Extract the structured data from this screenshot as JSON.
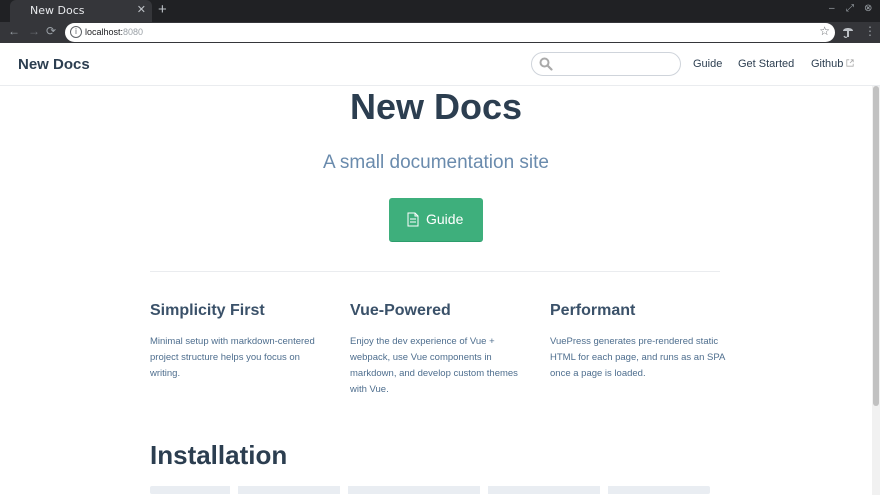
{
  "browser": {
    "tab_title": "New Docs",
    "tab_close": "✕",
    "new_tab": "+",
    "url_host": "localhost:",
    "url_port": "8080",
    "info_glyph": "i",
    "star_glyph": "☆",
    "back_glyph": "←",
    "forward_glyph": "→",
    "reload_glyph": "⟳",
    "menu_glyph": "⋮",
    "minimize_glyph": "–",
    "restore_glyph": "⤢",
    "close_glyph": "⊗"
  },
  "site": {
    "brand": "New Docs",
    "search": {
      "value": "",
      "placeholder": ""
    },
    "nav": [
      {
        "label": "Guide"
      },
      {
        "label": "Get Started"
      },
      {
        "label": "Github"
      }
    ]
  },
  "hero": {
    "title": "New Docs",
    "description": "A small documentation site",
    "action_label": "Guide"
  },
  "features": [
    {
      "title": "Simplicity First",
      "text": "Minimal setup with markdown-centered project structure helps you focus on writing."
    },
    {
      "title": "Vue-Powered",
      "text": "Enjoy the dev experience of Vue + webpack, use Vue components in markdown, and develop custom themes with Vue."
    },
    {
      "title": "Performant",
      "text": "VuePress generates pre-rendered static HTML for each page, and runs as an SPA once a page is loaded."
    }
  ],
  "content": {
    "installation_heading": "Installation"
  },
  "colors": {
    "accent": "#3eaf7c",
    "text": "#2c3e50",
    "muted": "#6a8bad"
  },
  "icons": {
    "search": "search-icon",
    "action": "document-icon",
    "external": "external-link-icon",
    "extension": "extension-icon"
  }
}
